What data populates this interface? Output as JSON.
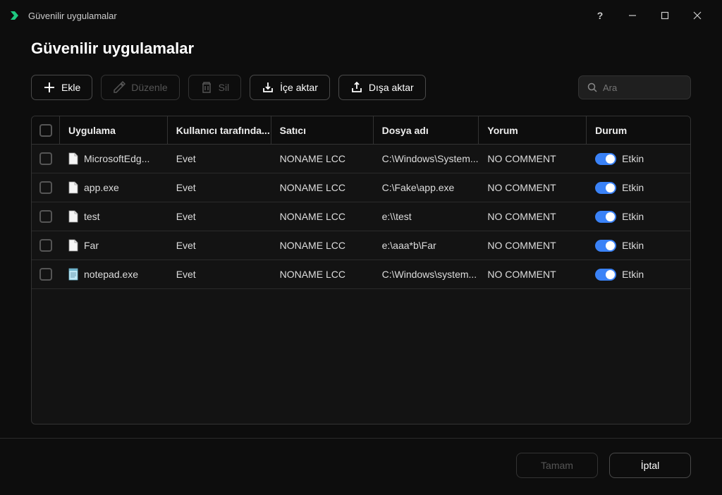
{
  "window": {
    "title": "Güvenilir uygulamalar"
  },
  "page": {
    "title": "Güvenilir uygulamalar"
  },
  "toolbar": {
    "add_label": "Ekle",
    "edit_label": "Düzenle",
    "delete_label": "Sil",
    "import_label": "İçe aktar",
    "export_label": "Dışa aktar"
  },
  "search": {
    "placeholder": "Ara"
  },
  "columns": {
    "app": "Uygulama",
    "user": "Kullanıcı tarafında...",
    "vendor": "Satıcı",
    "filename": "Dosya adı",
    "comment": "Yorum",
    "status": "Durum"
  },
  "rows": [
    {
      "app": "MicrosoftEdg...",
      "user": "Evet",
      "vendor": "NONAME LCC",
      "filename": "C:\\Windows\\System...",
      "comment": "NO COMMENT",
      "status": "Etkin",
      "icon": "generic"
    },
    {
      "app": "app.exe",
      "user": "Evet",
      "vendor": "NONAME LCC",
      "filename": "C:\\Fake\\app.exe",
      "comment": "NO COMMENT",
      "status": "Etkin",
      "icon": "generic"
    },
    {
      "app": "test",
      "user": "Evet",
      "vendor": "NONAME LCC",
      "filename": "e:\\\\test",
      "comment": "NO COMMENT",
      "status": "Etkin",
      "icon": "generic"
    },
    {
      "app": "Far",
      "user": "Evet",
      "vendor": "NONAME LCC",
      "filename": "e:\\aaa*b\\Far",
      "comment": "NO COMMENT",
      "status": "Etkin",
      "icon": "generic"
    },
    {
      "app": "notepad.exe",
      "user": "Evet",
      "vendor": "NONAME LCC",
      "filename": "C:\\Windows\\system...",
      "comment": "NO COMMENT",
      "status": "Etkin",
      "icon": "notepad"
    }
  ],
  "footer": {
    "ok_label": "Tamam",
    "cancel_label": "İptal"
  }
}
